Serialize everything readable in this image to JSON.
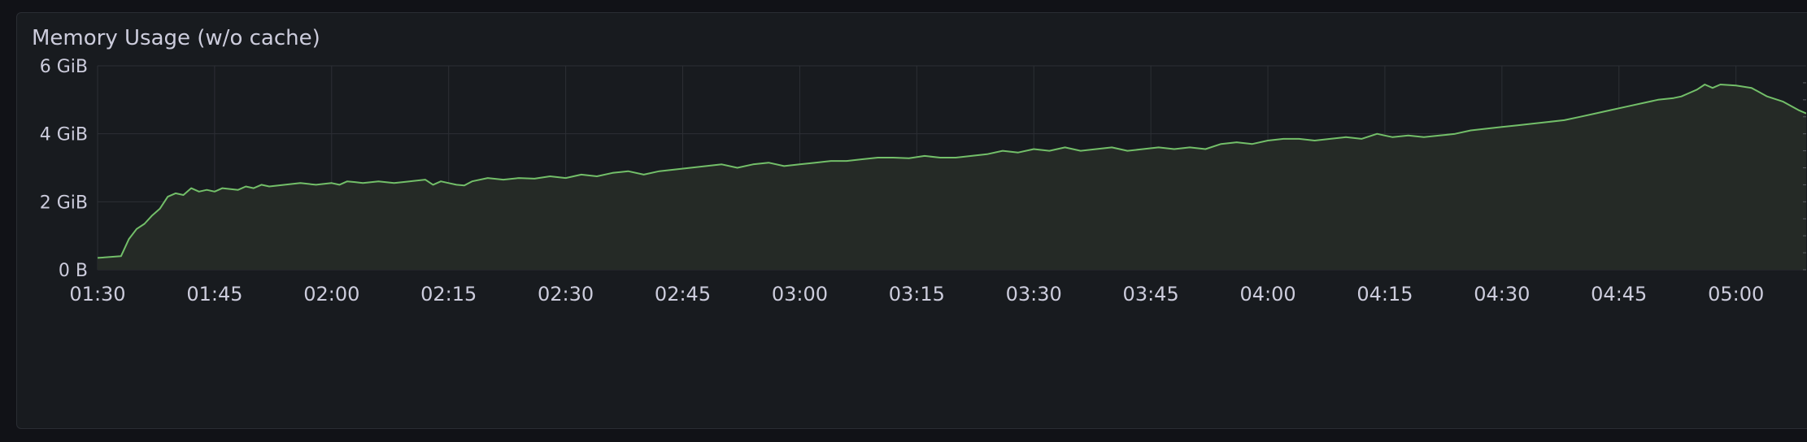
{
  "panel": {
    "title": "Memory Usage (w/o cache)"
  },
  "chart_data": {
    "type": "area",
    "title": "Memory Usage (w/o cache)",
    "xlabel": "",
    "ylabel": "",
    "x_ticks": [
      "01:30",
      "01:45",
      "02:00",
      "02:15",
      "02:30",
      "02:45",
      "03:00",
      "03:15",
      "03:30",
      "03:45",
      "04:00",
      "04:15",
      "04:30",
      "04:45",
      "05:00"
    ],
    "y_ticks": [
      {
        "value": 0,
        "label": "0 B"
      },
      {
        "value": 2,
        "label": "2 GiB"
      },
      {
        "value": 4,
        "label": "4 GiB"
      },
      {
        "value": 6,
        "label": "6 GiB"
      }
    ],
    "xlim": [
      "01:30",
      "05:09"
    ],
    "ylim": [
      0,
      6
    ],
    "y_unit": "GiB",
    "grid": true,
    "line_color": "#73bf69",
    "fill_color": "#252a26",
    "series": [
      {
        "x": [
          "01:30",
          "01:33",
          "01:34",
          "01:35",
          "01:36",
          "01:37",
          "01:38",
          "01:39",
          "01:40",
          "01:41",
          "01:42",
          "01:43",
          "01:44",
          "01:45",
          "01:46",
          "01:48",
          "01:49",
          "01:50",
          "01:51",
          "01:52",
          "01:54",
          "01:56",
          "01:58",
          "02:00",
          "02:01",
          "02:02",
          "02:03",
          "02:04",
          "02:06",
          "02:08",
          "02:10",
          "02:12",
          "02:13",
          "02:14",
          "02:15",
          "02:16",
          "02:17",
          "02:18",
          "02:20",
          "02:22",
          "02:24",
          "02:26",
          "02:28",
          "02:30",
          "02:32",
          "02:34",
          "02:36",
          "02:38",
          "02:40",
          "02:42",
          "02:44",
          "02:46",
          "02:48",
          "02:50",
          "02:52",
          "02:54",
          "02:56",
          "02:58",
          "03:00",
          "03:02",
          "03:04",
          "03:06",
          "03:08",
          "03:10",
          "03:12",
          "03:14",
          "03:16",
          "03:18",
          "03:20",
          "03:22",
          "03:24",
          "03:26",
          "03:28",
          "03:30",
          "03:32",
          "03:34",
          "03:36",
          "03:38",
          "03:40",
          "03:42",
          "03:44",
          "03:46",
          "03:48",
          "03:50",
          "03:52",
          "03:54",
          "03:56",
          "03:58",
          "04:00",
          "04:02",
          "04:04",
          "04:06",
          "04:08",
          "04:10",
          "04:12",
          "04:14",
          "04:15",
          "04:16",
          "04:18",
          "04:20",
          "04:22",
          "04:24",
          "04:26",
          "04:28",
          "04:30",
          "04:32",
          "04:34",
          "04:36",
          "04:38",
          "04:40",
          "04:42",
          "04:44",
          "04:46",
          "04:48",
          "04:50",
          "04:52",
          "04:53",
          "04:54",
          "04:55",
          "04:56",
          "04:57",
          "04:58",
          "05:00",
          "05:02",
          "05:04",
          "05:06",
          "05:08",
          "05:09"
        ],
        "values": [
          0.35,
          0.4,
          0.9,
          1.2,
          1.35,
          1.6,
          1.8,
          2.15,
          2.25,
          2.2,
          2.4,
          2.3,
          2.35,
          2.3,
          2.4,
          2.35,
          2.45,
          2.4,
          2.5,
          2.45,
          2.5,
          2.55,
          2.5,
          2.55,
          2.5,
          2.6,
          2.58,
          2.55,
          2.6,
          2.55,
          2.6,
          2.65,
          2.5,
          2.6,
          2.55,
          2.5,
          2.48,
          2.6,
          2.7,
          2.65,
          2.7,
          2.68,
          2.75,
          2.7,
          2.8,
          2.75,
          2.85,
          2.9,
          2.8,
          2.9,
          2.95,
          3.0,
          3.05,
          3.1,
          3.0,
          3.1,
          3.15,
          3.05,
          3.1,
          3.15,
          3.2,
          3.2,
          3.25,
          3.3,
          3.3,
          3.28,
          3.35,
          3.3,
          3.3,
          3.35,
          3.4,
          3.5,
          3.45,
          3.55,
          3.5,
          3.6,
          3.5,
          3.55,
          3.6,
          3.5,
          3.55,
          3.6,
          3.55,
          3.6,
          3.55,
          3.7,
          3.75,
          3.7,
          3.8,
          3.85,
          3.85,
          3.8,
          3.85,
          3.9,
          3.85,
          4.0,
          3.95,
          3.9,
          3.95,
          3.9,
          3.95,
          4.0,
          4.1,
          4.15,
          4.2,
          4.25,
          4.3,
          4.35,
          4.4,
          4.5,
          4.6,
          4.7,
          4.8,
          4.9,
          5.0,
          5.05,
          5.1,
          5.2,
          5.3,
          5.45,
          5.35,
          5.45,
          5.42,
          5.35,
          5.1,
          4.95,
          4.7,
          4.6
        ]
      }
    ]
  }
}
